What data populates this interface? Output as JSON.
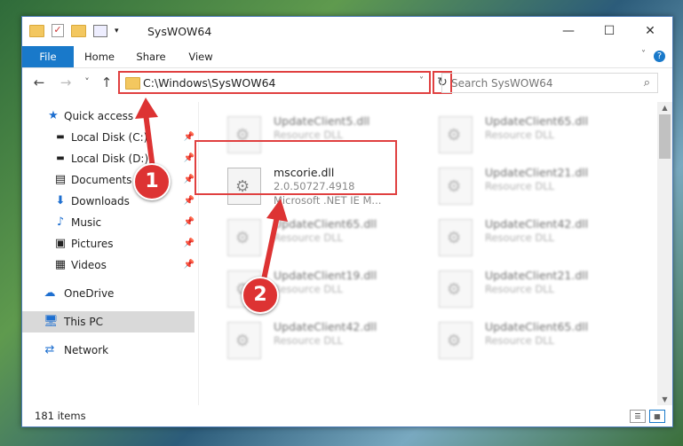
{
  "window": {
    "title": "SysWOW64",
    "controls": {
      "minimize": "—",
      "maximize": "☐",
      "close": "✕"
    }
  },
  "ribbon": {
    "tabs": [
      {
        "label": "File"
      },
      {
        "label": "Home"
      },
      {
        "label": "Share"
      },
      {
        "label": "View"
      }
    ],
    "help": "?"
  },
  "nav": {
    "back": "←",
    "forward": "→",
    "recent": "˅",
    "up": "↑",
    "address": "C:\\Windows\\SysWOW64",
    "refresh": "↻",
    "search_placeholder": "Search SysWOW64"
  },
  "sidebar": {
    "items": [
      {
        "label": "Quick access",
        "icon": "star-icon",
        "color": "#1e6fd0"
      },
      {
        "label": "Local Disk (C:)",
        "icon": "drive-icon",
        "pinned": true
      },
      {
        "label": "Local Disk (D:)",
        "icon": "drive-icon",
        "pinned": true
      },
      {
        "label": "Documents",
        "icon": "documents-icon",
        "pinned": true
      },
      {
        "label": "Downloads",
        "icon": "download-icon",
        "pinned": true
      },
      {
        "label": "Music",
        "icon": "music-icon",
        "pinned": true
      },
      {
        "label": "Pictures",
        "icon": "pictures-icon",
        "pinned": true
      },
      {
        "label": "Videos",
        "icon": "videos-icon",
        "pinned": true
      },
      {
        "label": "OneDrive",
        "icon": "cloud-icon"
      },
      {
        "label": "This PC",
        "icon": "computer-icon",
        "selected": true
      },
      {
        "label": "Network",
        "icon": "network-icon"
      }
    ]
  },
  "files": {
    "col1": [
      {
        "name": "UpdateClient5.dll",
        "type": "Resource DLL"
      },
      {
        "name": "mscorie.dll",
        "type": "2.0.50727.4918",
        "desc": "Microsoft .NET IE M...",
        "selected": true
      },
      {
        "name": "UpdateClient65.dll",
        "type": "Resource DLL"
      },
      {
        "name": "UpdateClient19.dll",
        "type": "Resource DLL"
      },
      {
        "name": "UpdateClient42.dll",
        "type": "Resource DLL"
      }
    ],
    "col2": [
      {
        "name": "UpdateClient65.dll",
        "type": "Resource DLL"
      },
      {
        "name": "UpdateClient21.dll",
        "type": "Resource DLL"
      },
      {
        "name": "UpdateClient42.dll",
        "type": "Resource DLL"
      },
      {
        "name": "UpdateClient21.dll",
        "type": "Resource DLL"
      },
      {
        "name": "UpdateClient65.dll",
        "type": "Resource DLL"
      }
    ]
  },
  "status": {
    "count": "181 items"
  },
  "markers": [
    "1",
    "2"
  ],
  "colors": {
    "accent": "#1979ca",
    "highlight": "#e04040"
  }
}
